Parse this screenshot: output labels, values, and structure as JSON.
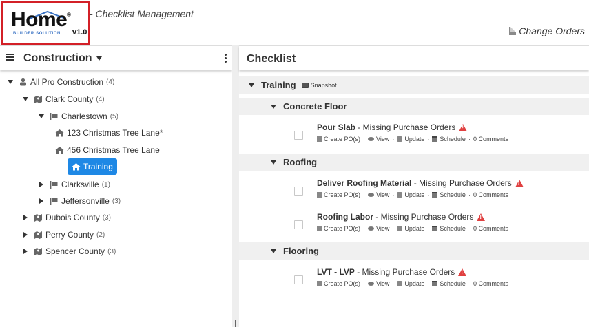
{
  "header": {
    "logo": {
      "word": "Home",
      "subtitle": "BUILDER SOLUTION",
      "version": "v1.0",
      "reg": "®"
    },
    "app_subtitle": "- Checklist Management",
    "change_orders_label": "Change Orders"
  },
  "left_panel": {
    "title": "Construction",
    "tree": [
      {
        "label": "All Pro Construction",
        "count": "(4)",
        "icon": "company-icon",
        "toggle": "expanded"
      },
      {
        "label": "Clark County",
        "count": "(4)",
        "icon": "map-icon",
        "toggle": "expanded"
      },
      {
        "label": "Charlestown",
        "count": "(5)",
        "icon": "flag-icon",
        "toggle": "expanded"
      },
      {
        "label": "123 Christmas Tree Lane*",
        "count": "",
        "icon": "house-icon",
        "toggle": "none"
      },
      {
        "label": "456 Christmas Tree Lane",
        "count": "",
        "icon": "house-icon",
        "toggle": "none"
      },
      {
        "label": "Training",
        "count": "",
        "icon": "house-icon",
        "toggle": "none",
        "selected": true
      },
      {
        "label": "Clarksville",
        "count": "(1)",
        "icon": "flag-icon",
        "toggle": "collapsed"
      },
      {
        "label": "Jeffersonville",
        "count": "(3)",
        "icon": "flag-icon",
        "toggle": "collapsed"
      },
      {
        "label": "Dubois County",
        "count": "(3)",
        "icon": "map-icon",
        "toggle": "collapsed"
      },
      {
        "label": "Perry County",
        "count": "(2)",
        "icon": "map-icon",
        "toggle": "collapsed"
      },
      {
        "label": "Spencer County",
        "count": "(3)",
        "icon": "map-icon",
        "toggle": "collapsed"
      }
    ]
  },
  "right_panel": {
    "title": "Checklist",
    "root_group": {
      "label": "Training",
      "snapshot_label": "Snapshot"
    },
    "actions": {
      "create_po": "Create PO(s)",
      "view": "View",
      "update": "Update",
      "schedule": "Schedule",
      "comments": "0 Comments"
    },
    "groups": [
      {
        "label": "Concrete Floor",
        "tasks": [
          {
            "name": "Pour Slab",
            "status": "- Missing Purchase Orders"
          }
        ]
      },
      {
        "label": "Roofing",
        "tasks": [
          {
            "name": "Deliver Roofing Material",
            "status": "- Missing Purchase Orders"
          },
          {
            "name": "Roofing Labor",
            "status": "- Missing Purchase Orders"
          }
        ]
      },
      {
        "label": "Flooring",
        "tasks": [
          {
            "name": "LVT - LVP",
            "status": "- Missing Purchase Orders"
          }
        ]
      }
    ]
  },
  "colors": {
    "selected": "#1e88e5",
    "logo_border": "#d32027",
    "warning": "#e04040",
    "group_bg": "#f0f0f0"
  }
}
